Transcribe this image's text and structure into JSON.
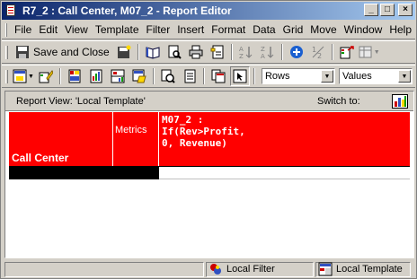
{
  "window": {
    "title": "R7_2 : Call Center, M07_2 - Report Editor",
    "caption_buttons": [
      "_",
      "□",
      "×"
    ]
  },
  "menu": {
    "items": [
      "File",
      "Edit",
      "View",
      "Template",
      "Filter",
      "Insert",
      "Format",
      "Data",
      "Grid",
      "Move",
      "Window",
      "Help"
    ]
  },
  "toolbar1": {
    "save_close_label": "Save and Close",
    "buttons": [
      "save-close-icon",
      "save-icon",
      "open-book-icon",
      "print-preview-icon",
      "print-icon",
      "report-options-icon",
      "sort-ascending-icon",
      "sort-descending-icon",
      "add-icon",
      "subtotals-icon",
      "export-icon",
      "outline-icon"
    ]
  },
  "toolbar2": {
    "rows_combo_value": "Rows",
    "values_combo_value": "Values",
    "buttons": [
      "layout-icon",
      "edit-icon",
      "grid-view-icon",
      "graph-view-icon",
      "grid-graph-icon",
      "sql-view-icon",
      "object-browser-icon",
      "page-icon",
      "copy-icon",
      "cursor-icon"
    ]
  },
  "report": {
    "view_label": "Report View: 'Local Template'",
    "switch_to_label": "Switch to:",
    "switch_icon": "chart-view-icon",
    "header_color": "#ff0000",
    "row_header": "Call Center",
    "metrics_header": "Metrics",
    "metric_formula": "M07_2 :\nIf(Rev>Profit,\n0, Revenue)"
  },
  "statusbar": {
    "filter_label": "Local Filter",
    "template_label": "Local Template"
  }
}
